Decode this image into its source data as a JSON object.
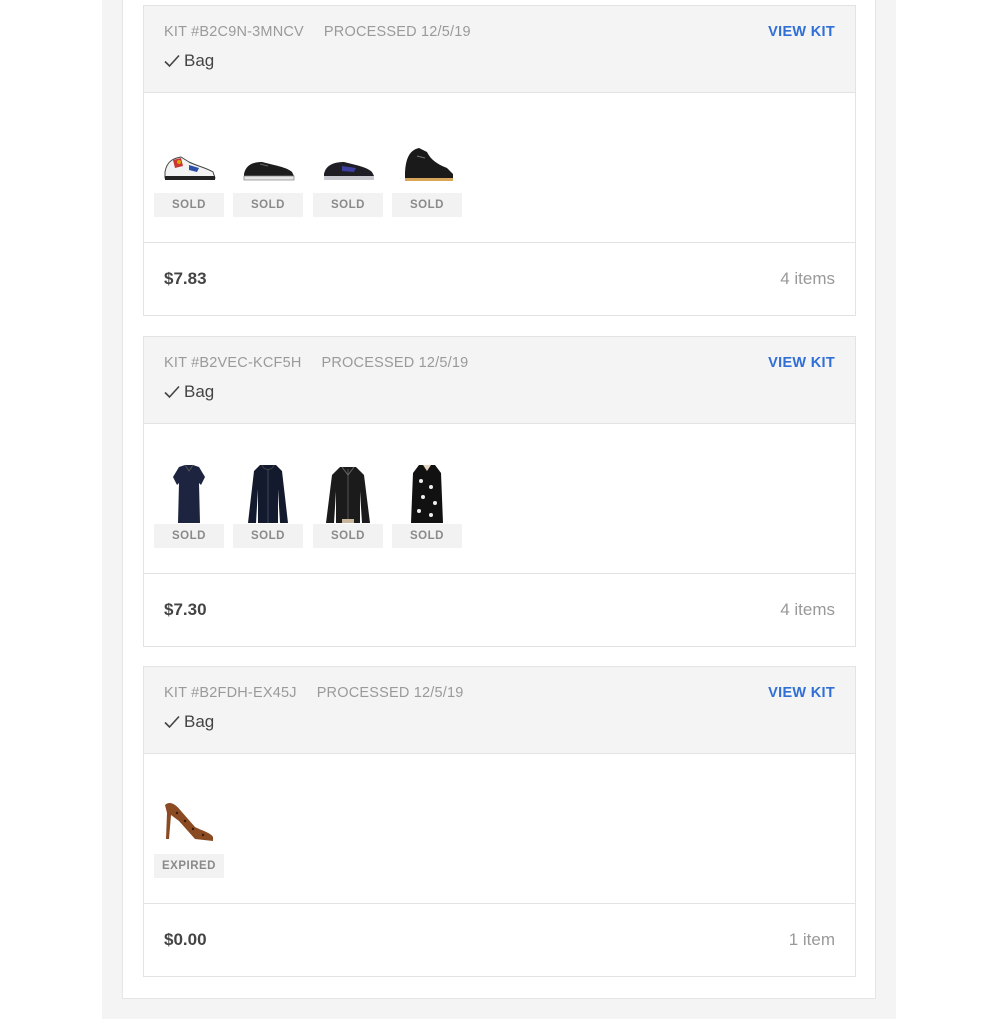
{
  "kits": [
    {
      "kit_id": "KIT #B2C9N-3MNCV",
      "processed": "PROCESSED 12/5/19",
      "view_label": "VIEW KIT",
      "bag_label": "Bag",
      "items": [
        {
          "kind": "sneaker-white",
          "status": "SOLD"
        },
        {
          "kind": "sneaker-black-low",
          "status": "SOLD"
        },
        {
          "kind": "sneaker-black-blue",
          "status": "SOLD"
        },
        {
          "kind": "sneaker-black-high",
          "status": "SOLD"
        }
      ],
      "price": "$7.83",
      "count": "4 items"
    },
    {
      "kit_id": "KIT #B2VEC-KCF5H",
      "processed": "PROCESSED 12/5/19",
      "view_label": "VIEW KIT",
      "bag_label": "Bag",
      "items": [
        {
          "kind": "blouse-navy",
          "status": "SOLD"
        },
        {
          "kind": "jacket-navy",
          "status": "SOLD"
        },
        {
          "kind": "jacket-black-leather",
          "status": "SOLD"
        },
        {
          "kind": "dress-floral",
          "status": "SOLD"
        }
      ],
      "price": "$7.30",
      "count": "4 items"
    },
    {
      "kit_id": "KIT #B2FDH-EX45J",
      "processed": "PROCESSED 12/5/19",
      "view_label": "VIEW KIT",
      "bag_label": "Bag",
      "items": [
        {
          "kind": "heel-leopard",
          "status": "EXPIRED"
        }
      ],
      "price": "$0.00",
      "count": "1 item"
    }
  ],
  "colors": {
    "link": "#2f6fd6",
    "header_bg": "#f4f4f4",
    "badge_bg": "#f2f2f2"
  }
}
